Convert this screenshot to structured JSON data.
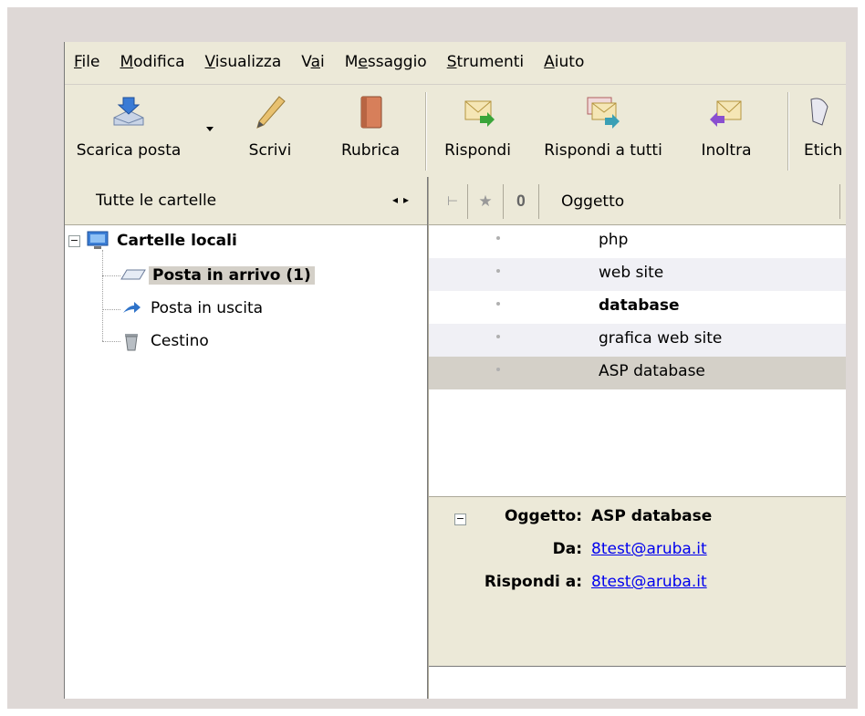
{
  "menu": {
    "items": [
      {
        "label_pre": "",
        "accel": "F",
        "label_post": "ile"
      },
      {
        "label_pre": "",
        "accel": "M",
        "label_post": "odifica"
      },
      {
        "label_pre": "",
        "accel": "V",
        "label_post": "isualizza"
      },
      {
        "label_pre": "V",
        "accel": "a",
        "label_post": "i"
      },
      {
        "label_pre": "M",
        "accel": "e",
        "label_post": "ssaggio"
      },
      {
        "label_pre": "",
        "accel": "S",
        "label_post": "trumenti"
      },
      {
        "label_pre": "",
        "accel": "A",
        "label_post": "iuto"
      }
    ]
  },
  "toolbar": {
    "get_mail": "Scarica posta",
    "write": "Scrivi",
    "address_book": "Rubrica",
    "reply": "Rispondi",
    "reply_all": "Rispondi a tutti",
    "forward": "Inoltra",
    "tag": "Etich"
  },
  "folders": {
    "header": "Tutte le cartelle",
    "root": "Cartelle locali",
    "inbox": "Posta in arrivo (1)",
    "outbox": "Posta in uscita",
    "trash": "Cestino"
  },
  "thread": {
    "subject_header": "Oggetto",
    "messages": [
      {
        "subject": "php",
        "unread": false
      },
      {
        "subject": "web site",
        "unread": false
      },
      {
        "subject": "database",
        "unread": true
      },
      {
        "subject": "grafica web site",
        "unread": false
      },
      {
        "subject": "ASP database",
        "unread": false
      }
    ]
  },
  "message": {
    "subject_label": "Oggetto:",
    "subject_value": "ASP database",
    "from_label": "Da:",
    "from_value": "8test@aruba.it",
    "reply_to_label": "Rispondi a:",
    "reply_to_value": "8test@aruba.it"
  }
}
